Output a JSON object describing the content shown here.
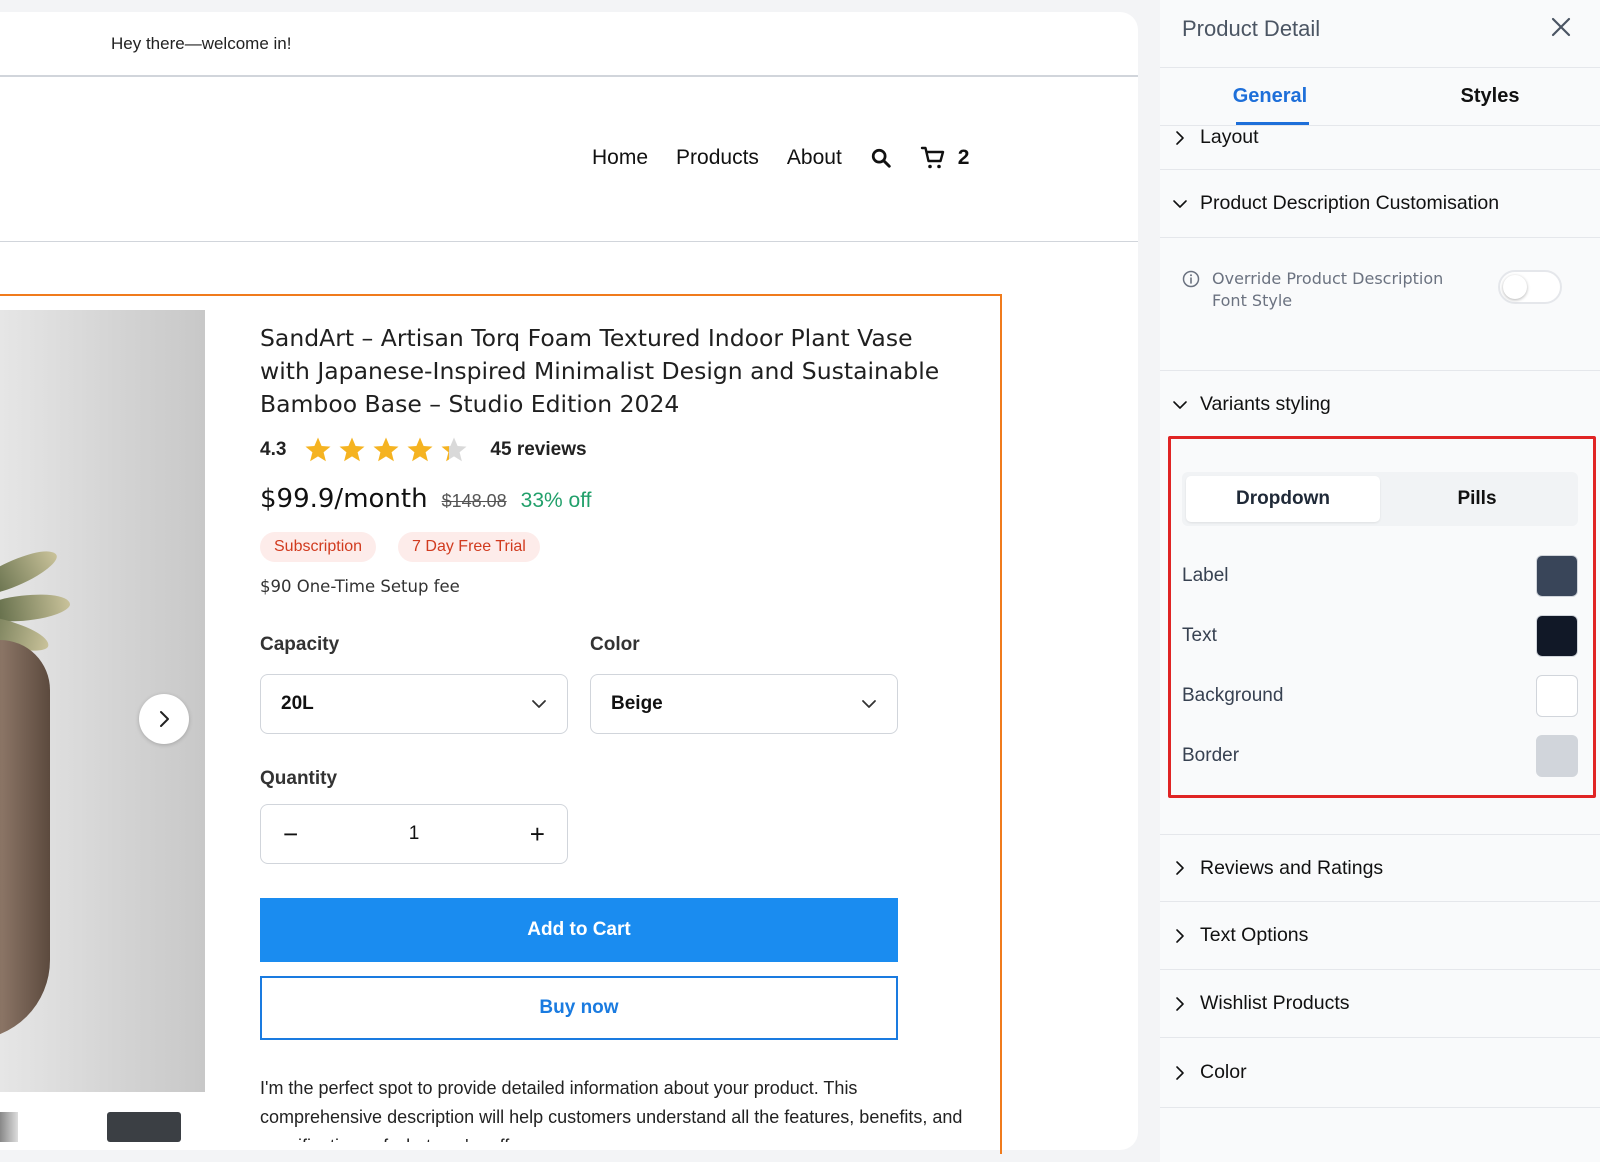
{
  "preview": {
    "welcome": "Hey there—welcome in!",
    "nav": [
      "Home",
      "Products",
      "About"
    ],
    "cart_count": "2",
    "product": {
      "title": "SandArt – Artisan Torq Foam Textured Indoor Plant Vase with Japanese-Inspired Minimalist Design and Sustainable Bamboo Base – Studio Edition 2024",
      "rating": "4.3",
      "rating_value": 4.3,
      "reviews": "45 reviews",
      "price": "$99.9/month",
      "old_price": "$148.08",
      "discount": "33% off",
      "badges": [
        "Subscription",
        "7 Day Free Trial"
      ],
      "setup_fee": "$90 One-Time Setup fee",
      "capacity_label": "Capacity",
      "capacity_value": "20L",
      "color_label": "Color",
      "color_value": "Beige",
      "quantity_label": "Quantity",
      "quantity_value": "1",
      "add_to_cart": "Add to Cart",
      "buy_now": "Buy now",
      "description": "I'm the perfect spot to provide detailed information about your product. This comprehensive description will help customers understand all the features, benefits, and specifications of what you're off"
    }
  },
  "panel": {
    "title": "Product Detail",
    "tabs": [
      "General",
      "Styles"
    ],
    "sections": {
      "layout": "Layout",
      "desc_custom": "Product Description Customisation",
      "override": "Override Product Description Font Style",
      "variants": "Variants styling",
      "reviews": "Reviews and Ratings",
      "text_options": "Text Options",
      "wishlist": "Wishlist Products",
      "color": "Color"
    },
    "variant_modes": [
      "Dropdown",
      "Pills"
    ],
    "color_rows": [
      {
        "label": "Label",
        "color": "#394559"
      },
      {
        "label": "Text",
        "color": "#111827"
      },
      {
        "label": "Background",
        "color": "#ffffff"
      },
      {
        "label": "Border",
        "color": "#d1d5db"
      }
    ]
  },
  "colors": {
    "accent": "#1e6fd9",
    "primary_button": "#1a8cf0",
    "highlight": "#e02424",
    "selection_frame": "#f07b1c",
    "star": "#f5b321",
    "discount": "#22a06b"
  }
}
